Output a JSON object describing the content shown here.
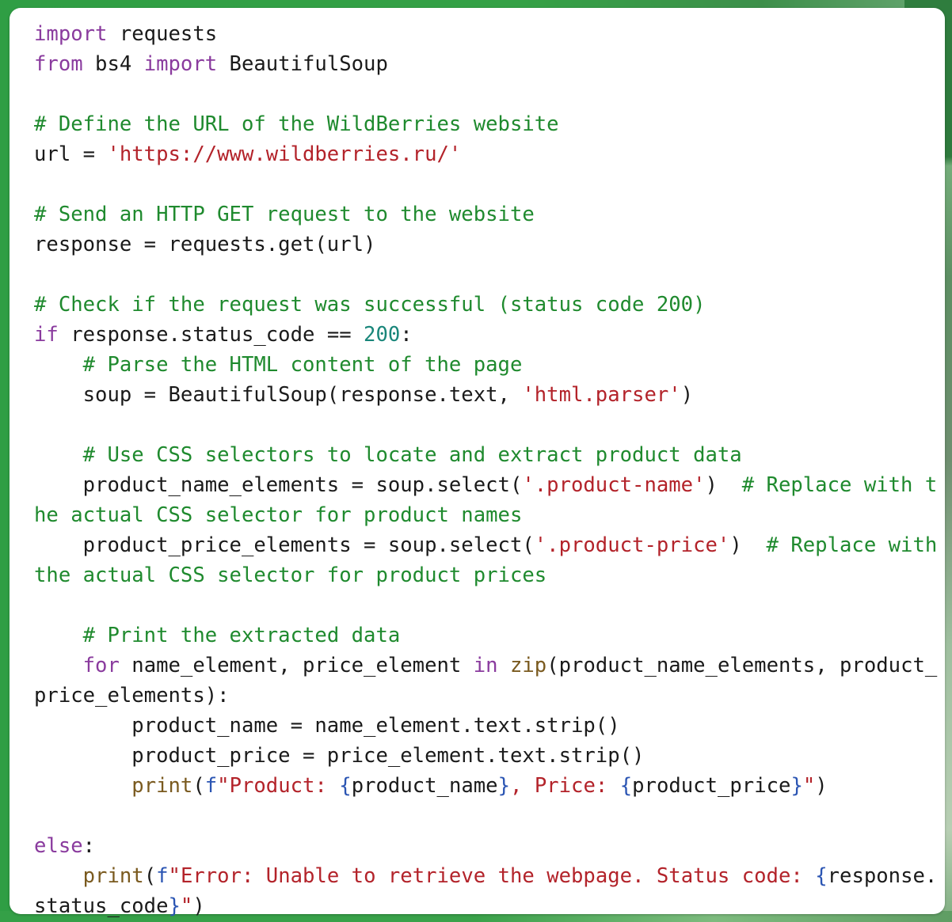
{
  "background": {
    "accent": "#2f9e44",
    "card": "#ffffff"
  },
  "syntax_colors": {
    "keyword": "#8a3b9e",
    "comment": "#1f8a2e",
    "string": "#b3232a",
    "number": "#19867a",
    "builtin": "#7a5a1f",
    "brace": "#2b55b3",
    "plain": "#1a1a1a"
  },
  "code": {
    "language": "python",
    "lines": [
      [
        [
          "kw",
          "import"
        ],
        [
          "pl",
          " requests"
        ]
      ],
      [
        [
          "kw",
          "from"
        ],
        [
          "pl",
          " bs4 "
        ],
        [
          "kw",
          "import"
        ],
        [
          "pl",
          " BeautifulSoup"
        ]
      ],
      [],
      [
        [
          "cm",
          "# Define the URL of the WildBerries website"
        ]
      ],
      [
        [
          "pl",
          "url = "
        ],
        [
          "st",
          "'https://www.wildberries.ru/'"
        ]
      ],
      [],
      [
        [
          "cm",
          "# Send an HTTP GET request to the website"
        ]
      ],
      [
        [
          "pl",
          "response = requests.get(url)"
        ]
      ],
      [],
      [
        [
          "cm",
          "# Check if the request was successful (status code 200)"
        ]
      ],
      [
        [
          "kw",
          "if"
        ],
        [
          "pl",
          " response.status_code == "
        ],
        [
          "nm",
          "200"
        ],
        [
          "pl",
          ":"
        ]
      ],
      [
        [
          "pl",
          "    "
        ],
        [
          "cm",
          "# Parse the HTML content of the page"
        ]
      ],
      [
        [
          "pl",
          "    soup = BeautifulSoup(response.text, "
        ],
        [
          "st",
          "'html.parser'"
        ],
        [
          "pl",
          ")"
        ]
      ],
      [],
      [
        [
          "pl",
          "    "
        ],
        [
          "cm",
          "# Use CSS selectors to locate and extract product data"
        ]
      ],
      [
        [
          "pl",
          "    product_name_elements = soup.select("
        ],
        [
          "st",
          "'.product-name'"
        ],
        [
          "pl",
          ")  "
        ],
        [
          "cm",
          "# Replace with t"
        ]
      ],
      [
        [
          "cm",
          "he actual CSS selector for product names"
        ]
      ],
      [
        [
          "pl",
          "    product_price_elements = soup.select("
        ],
        [
          "st",
          "'.product-price'"
        ],
        [
          "pl",
          ")  "
        ],
        [
          "cm",
          "# Replace with"
        ]
      ],
      [
        [
          "cm",
          "the actual CSS selector for product prices"
        ]
      ],
      [],
      [
        [
          "pl",
          "    "
        ],
        [
          "cm",
          "# Print the extracted data"
        ]
      ],
      [
        [
          "pl",
          "    "
        ],
        [
          "kw",
          "for"
        ],
        [
          "pl",
          " name_element, price_element "
        ],
        [
          "kw",
          "in"
        ],
        [
          "pl",
          " "
        ],
        [
          "fn",
          "zip"
        ],
        [
          "pl",
          "(product_name_elements, product_"
        ]
      ],
      [
        [
          "pl",
          "price_elements):"
        ]
      ],
      [
        [
          "pl",
          "        product_name = name_element.text.strip()"
        ]
      ],
      [
        [
          "pl",
          "        product_price = price_element.text.strip()"
        ]
      ],
      [
        [
          "pl",
          "        "
        ],
        [
          "fn",
          "print"
        ],
        [
          "pl",
          "("
        ],
        [
          "br",
          "f"
        ],
        [
          "st",
          "\"Product: "
        ],
        [
          "br",
          "{"
        ],
        [
          "pl",
          "product_name"
        ],
        [
          "br",
          "}"
        ],
        [
          "st",
          ", Price: "
        ],
        [
          "br",
          "{"
        ],
        [
          "pl",
          "product_price"
        ],
        [
          "br",
          "}"
        ],
        [
          "st",
          "\""
        ],
        [
          "pl",
          ")"
        ]
      ],
      [],
      [
        [
          "kw",
          "else"
        ],
        [
          "pl",
          ":"
        ]
      ],
      [
        [
          "pl",
          "    "
        ],
        [
          "fn",
          "print"
        ],
        [
          "pl",
          "("
        ],
        [
          "br",
          "f"
        ],
        [
          "st",
          "\"Error: Unable to retrieve the webpage. Status code: "
        ],
        [
          "br",
          "{"
        ],
        [
          "pl",
          "response."
        ]
      ],
      [
        [
          "pl",
          "status_code"
        ],
        [
          "br",
          "}"
        ],
        [
          "st",
          "\""
        ],
        [
          "pl",
          ")"
        ]
      ]
    ]
  }
}
